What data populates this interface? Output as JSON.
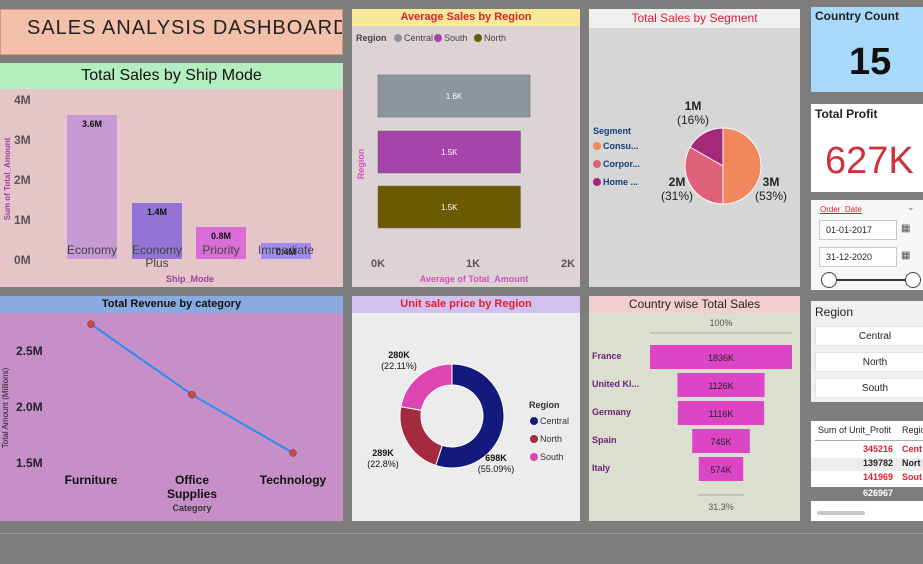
{
  "dashboard_title": "SALES ANALYSIS DASHBOARD",
  "ship_mode": {
    "title": "Total Sales by Ship Mode",
    "y_axis_label": "Sum of Total_Amount",
    "x_axis_label": "Ship_Mode",
    "y_ticks": [
      "4M",
      "3M",
      "2M",
      "1M",
      "0M"
    ]
  },
  "avg_region": {
    "title": "Average Sales by Region",
    "legend_title": "Region",
    "legend": [
      "Central",
      "South",
      "North"
    ],
    "y_axis_label": "Region",
    "x_axis_label": "Average of Total_Amount",
    "x_ticks": [
      "0K",
      "1K",
      "2K"
    ]
  },
  "segment": {
    "title": "Total Sales by Segment",
    "legend_title": "Segment",
    "legend": [
      "Consu...",
      "Corpor...",
      "Home ..."
    ]
  },
  "country_count": {
    "title": "Country Count",
    "value": "15"
  },
  "total_profit": {
    "title": "Total Profit",
    "value": "627K"
  },
  "order_date": {
    "label": "Order_Date",
    "from": "01-01-2017",
    "to": "31-12-2020"
  },
  "revenue": {
    "title": "Total Revenue by category",
    "y_axis_label": "Total Amount (Millions)",
    "x_axis_label": "Category",
    "y_ticks": [
      "2.5M",
      "2.0M",
      "1.5M"
    ]
  },
  "unit_price": {
    "title": "Unit sale price by Region",
    "legend_title": "Region",
    "legend": [
      "Central",
      "North",
      "South"
    ]
  },
  "country_sales": {
    "title": "Country wise Total Sales",
    "top_pct": "100%",
    "bottom_pct": "31.3%"
  },
  "region_slicer": {
    "title": "Region",
    "options": [
      "Central",
      "North",
      "South"
    ]
  },
  "profit_table": {
    "headers": [
      "Sum of Unit_Profit",
      "Regio"
    ],
    "rows": [
      {
        "value": "345216",
        "region": "Cent"
      },
      {
        "value": "139782",
        "region": "Nort"
      },
      {
        "value": "141969",
        "region": "Sout"
      }
    ],
    "total": "626967"
  },
  "chart_data": [
    {
      "type": "bar",
      "title": "Total Sales by Ship Mode",
      "xlabel": "Ship_Mode",
      "ylabel": "Sum of Total_Amount",
      "categories": [
        "Economy",
        "Economy Plus",
        "Priority",
        "Immediate"
      ],
      "values": [
        3.6,
        1.4,
        0.8,
        0.4
      ],
      "value_labels": [
        "3.6M",
        "1.4M",
        "0.8M",
        "0.4M"
      ],
      "colors": [
        "#c69ad2",
        "#9374d4",
        "#d96fd6",
        "#a08cf0"
      ],
      "ylim": [
        0,
        4
      ]
    },
    {
      "type": "bar",
      "title": "Average Sales by Region",
      "xlabel": "Average of Total_Amount",
      "ylabel": "Region",
      "categories": [
        "Central",
        "South",
        "North"
      ],
      "values": [
        1.6,
        1.5,
        1.5
      ],
      "value_labels": [
        "1.6K",
        "1.5K",
        "1.5K"
      ],
      "colors": [
        "#8d959f",
        "#a744a9",
        "#6c5a00"
      ],
      "xlim": [
        0,
        2
      ]
    },
    {
      "type": "pie",
      "title": "Total Sales by Segment",
      "categories": [
        "Consumer",
        "Corporate",
        "Home Office"
      ],
      "values": [
        3,
        2,
        1
      ],
      "value_labels": [
        "3M\n(53%)",
        "2M\n(31%)",
        "1M\n(16%)"
      ],
      "percents": [
        53,
        31,
        16
      ],
      "colors": [
        "#f1875c",
        "#e0617a",
        "#a6287b"
      ]
    },
    {
      "type": "line",
      "title": "Total Revenue by category",
      "xlabel": "Category",
      "ylabel": "Total Amount (Millions)",
      "categories": [
        "Furniture",
        "Office Supplies",
        "Technology"
      ],
      "values": [
        2.74,
        2.11,
        1.59
      ],
      "ylim": [
        1.4,
        2.85
      ],
      "color": "#2d8cf0"
    },
    {
      "type": "pie",
      "title": "Unit sale price by Region",
      "categories": [
        "Central",
        "North",
        "South"
      ],
      "values": [
        698,
        289,
        280
      ],
      "value_labels": [
        "698K\n(55.09%)",
        "289K\n(22.8%)",
        "280K\n(22.11%)"
      ],
      "colors": [
        "#131a7c",
        "#a52a3f",
        "#dd45b0"
      ]
    },
    {
      "type": "bar",
      "title": "Country wise Total Sales",
      "categories": [
        "France",
        "United Ki...",
        "Germany",
        "Spain",
        "Italy"
      ],
      "values": [
        1836,
        1126,
        1116,
        745,
        574
      ],
      "value_labels": [
        "1836K",
        "1126K",
        "1116K",
        "745K",
        "574K"
      ],
      "color": "#dc45c6"
    }
  ]
}
